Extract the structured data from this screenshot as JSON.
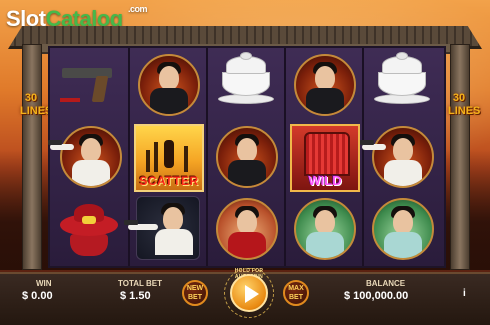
{
  "branding": {
    "logo_part1": "Slot",
    "logo_part2": "Catalog",
    "logo_suffix": ".com"
  },
  "side_labels": {
    "left": "30\nLINES",
    "right": "30\nLINES"
  },
  "reel_symbols": [
    [
      "pistol",
      "man-white-shirt",
      "red-hat"
    ],
    [
      "man-black-coat",
      "scatter",
      "man-white-shirt"
    ],
    [
      "teacup",
      "man-black-coat",
      "woman-red-dress"
    ],
    [
      "man-black-coat",
      "wild",
      "woman-teal-dress"
    ],
    [
      "teacup",
      "man-white-shirt",
      "woman-teal-dress"
    ]
  ],
  "symbol_texts": {
    "scatter": "SCATTER",
    "wild": "WILD"
  },
  "bottom_bar": {
    "win_label": "WIN",
    "win_value": "$ 0.00",
    "total_bet_label": "TOTAL BET",
    "total_bet_value": "$ 1.50",
    "new_bet_label": "NEW\nBET",
    "hold_label": "HOLD FOR AUTOSPIN",
    "max_bet_label": "MAX\nBET",
    "balance_label": "BALANCE",
    "balance_value": "$ 100,000.00",
    "info_label": "i"
  },
  "colors": {
    "accent_gold": "#f5b21a",
    "logo_green": "#46b84a",
    "button_orange": "#e08a1e"
  }
}
